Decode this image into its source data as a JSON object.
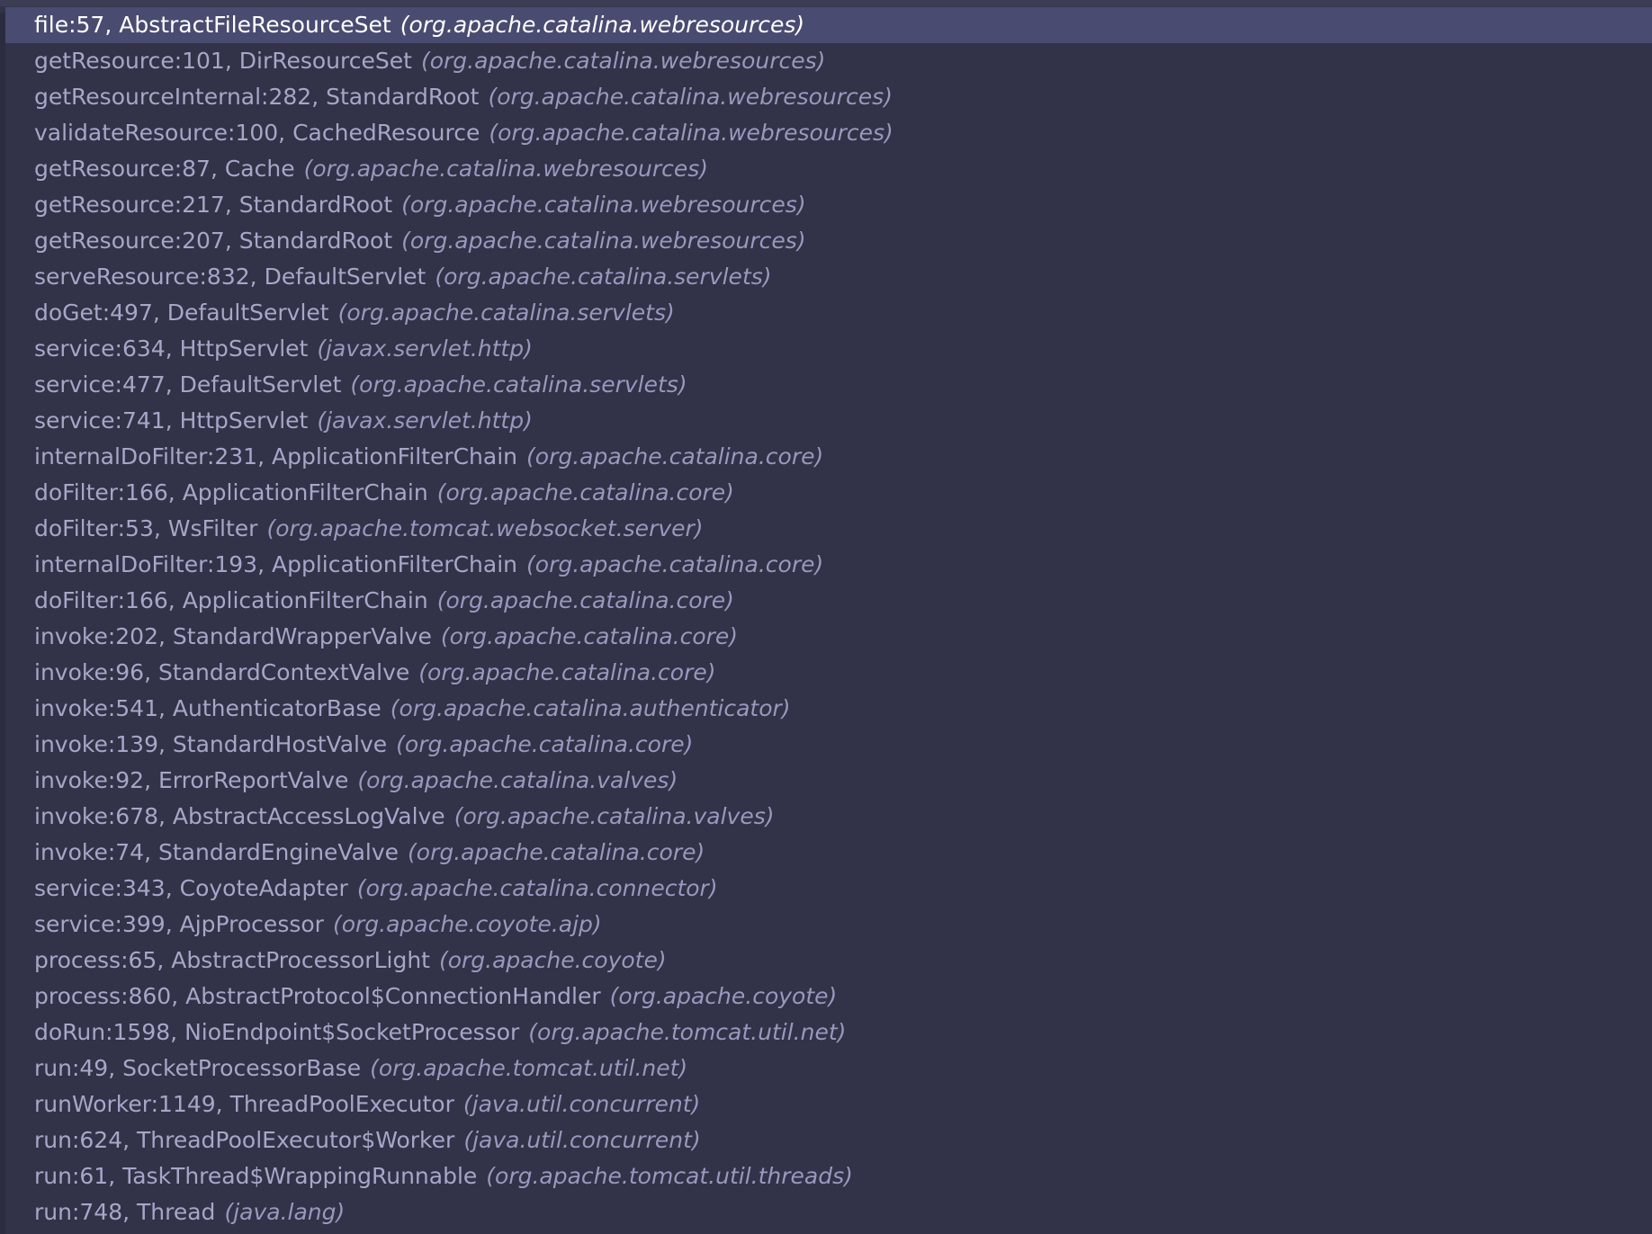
{
  "debugger": {
    "frames": [
      {
        "method": "file:57",
        "class": "AbstractFileResourceSet",
        "package": "(org.apache.catalina.webresources)",
        "selected": true
      },
      {
        "method": "getResource:101",
        "class": "DirResourceSet",
        "package": "(org.apache.catalina.webresources)"
      },
      {
        "method": "getResourceInternal:282",
        "class": "StandardRoot",
        "package": "(org.apache.catalina.webresources)"
      },
      {
        "method": "validateResource:100",
        "class": "CachedResource",
        "package": "(org.apache.catalina.webresources)"
      },
      {
        "method": "getResource:87",
        "class": "Cache",
        "package": "(org.apache.catalina.webresources)"
      },
      {
        "method": "getResource:217",
        "class": "StandardRoot",
        "package": "(org.apache.catalina.webresources)"
      },
      {
        "method": "getResource:207",
        "class": "StandardRoot",
        "package": "(org.apache.catalina.webresources)"
      },
      {
        "method": "serveResource:832",
        "class": "DefaultServlet",
        "package": "(org.apache.catalina.servlets)"
      },
      {
        "method": "doGet:497",
        "class": "DefaultServlet",
        "package": "(org.apache.catalina.servlets)"
      },
      {
        "method": "service:634",
        "class": "HttpServlet",
        "package": "(javax.servlet.http)"
      },
      {
        "method": "service:477",
        "class": "DefaultServlet",
        "package": "(org.apache.catalina.servlets)"
      },
      {
        "method": "service:741",
        "class": "HttpServlet",
        "package": "(javax.servlet.http)"
      },
      {
        "method": "internalDoFilter:231",
        "class": "ApplicationFilterChain",
        "package": "(org.apache.catalina.core)"
      },
      {
        "method": "doFilter:166",
        "class": "ApplicationFilterChain",
        "package": "(org.apache.catalina.core)"
      },
      {
        "method": "doFilter:53",
        "class": "WsFilter",
        "package": "(org.apache.tomcat.websocket.server)"
      },
      {
        "method": "internalDoFilter:193",
        "class": "ApplicationFilterChain",
        "package": "(org.apache.catalina.core)"
      },
      {
        "method": "doFilter:166",
        "class": "ApplicationFilterChain",
        "package": "(org.apache.catalina.core)"
      },
      {
        "method": "invoke:202",
        "class": "StandardWrapperValve",
        "package": "(org.apache.catalina.core)"
      },
      {
        "method": "invoke:96",
        "class": "StandardContextValve",
        "package": "(org.apache.catalina.core)"
      },
      {
        "method": "invoke:541",
        "class": "AuthenticatorBase",
        "package": "(org.apache.catalina.authenticator)"
      },
      {
        "method": "invoke:139",
        "class": "StandardHostValve",
        "package": "(org.apache.catalina.core)"
      },
      {
        "method": "invoke:92",
        "class": "ErrorReportValve",
        "package": "(org.apache.catalina.valves)"
      },
      {
        "method": "invoke:678",
        "class": "AbstractAccessLogValve",
        "package": "(org.apache.catalina.valves)"
      },
      {
        "method": "invoke:74",
        "class": "StandardEngineValve",
        "package": "(org.apache.catalina.core)"
      },
      {
        "method": "service:343",
        "class": "CoyoteAdapter",
        "package": "(org.apache.catalina.connector)"
      },
      {
        "method": "service:399",
        "class": "AjpProcessor",
        "package": "(org.apache.coyote.ajp)"
      },
      {
        "method": "process:65",
        "class": "AbstractProcessorLight",
        "package": "(org.apache.coyote)"
      },
      {
        "method": "process:860",
        "class": "AbstractProtocol$ConnectionHandler",
        "package": "(org.apache.coyote)"
      },
      {
        "method": "doRun:1598",
        "class": "NioEndpoint$SocketProcessor",
        "package": "(org.apache.tomcat.util.net)"
      },
      {
        "method": "run:49",
        "class": "SocketProcessorBase",
        "package": "(org.apache.tomcat.util.net)"
      },
      {
        "method": "runWorker:1149",
        "class": "ThreadPoolExecutor",
        "package": "(java.util.concurrent)"
      },
      {
        "method": "run:624",
        "class": "ThreadPoolExecutor$Worker",
        "package": "(java.util.concurrent)"
      },
      {
        "method": "run:61",
        "class": "TaskThread$WrappingRunnable",
        "package": "(org.apache.tomcat.util.threads)"
      },
      {
        "method": "run:748",
        "class": "Thread",
        "package": "(java.lang)"
      }
    ]
  },
  "colors": {
    "panel_background": "#323248",
    "selected_row": "#4a4b71",
    "frame_text": "#a6a7c8",
    "selected_text": "#ffffff"
  }
}
